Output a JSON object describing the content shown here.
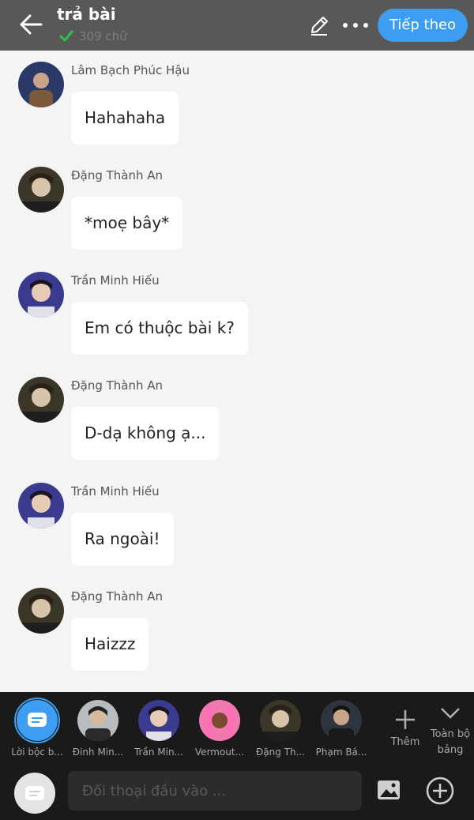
{
  "header": {
    "title": "trả bài",
    "word_count": "309 chữ",
    "next_label": "Tiếp theo"
  },
  "messages": [
    {
      "name": "Lâm Bạch Phúc Hậu",
      "text": "Hahahaha"
    },
    {
      "name": "Đặng Thành An",
      "text": "*moẹ bây*"
    },
    {
      "name": "Trần Minh Hiếu",
      "text": "Em có thuộc bài k?"
    },
    {
      "name": "Đặng Thành An",
      "text": "D-dạ không ạ..."
    },
    {
      "name": "Trần Minh Hiếu",
      "text": "Ra ngoài!"
    },
    {
      "name": "Đặng Thành An",
      "text": "Haizzz"
    }
  ],
  "characters": [
    {
      "label": "Lời bộc b..."
    },
    {
      "label": "Đinh Min..."
    },
    {
      "label": "Trần Min..."
    },
    {
      "label": "Vermout..."
    },
    {
      "label": "Đặng Th..."
    },
    {
      "label": "Phạm Bá..."
    }
  ],
  "add_label": "Thêm",
  "all_label": "Toàn bộ bảng",
  "composer": {
    "placeholder": "Đối thoại đầu vào ..."
  },
  "colors": {
    "header_bg": "#585858",
    "accent": "#3d9df0",
    "check": "#2fbf4a",
    "bottom_bg": "#1a1a1a"
  }
}
